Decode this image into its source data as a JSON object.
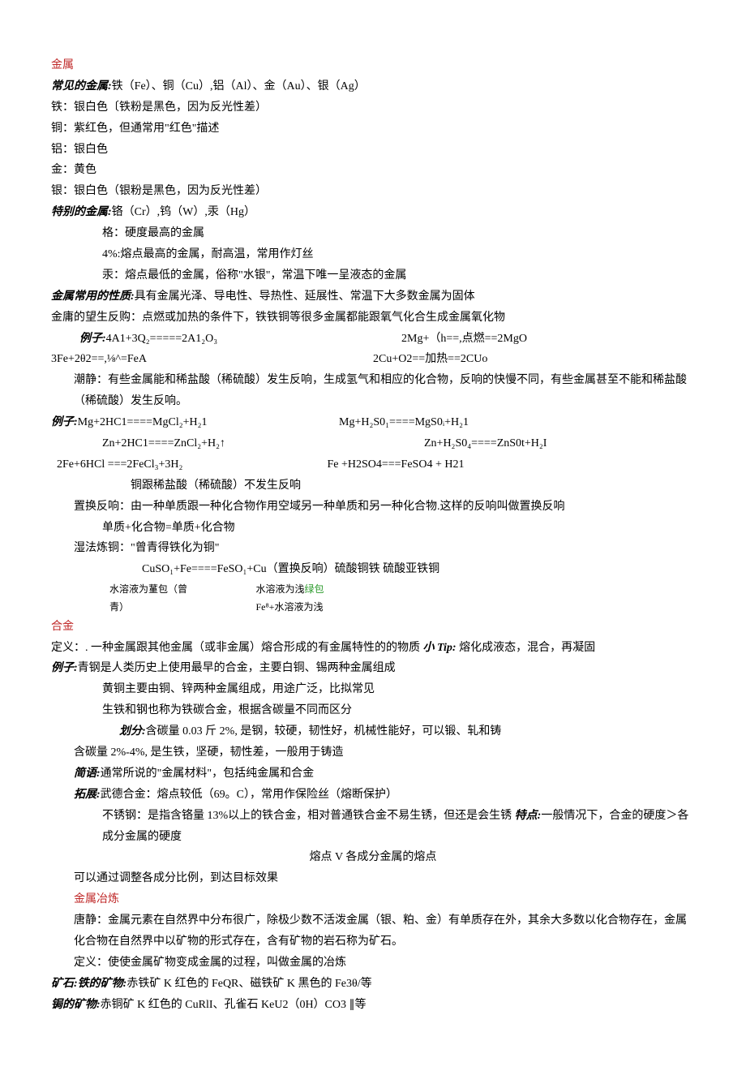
{
  "s1": {
    "title": "金属",
    "common_label": "常见的金属:",
    "common_text": "铁（Fe）、铜（Cu）,铝（Al）、金（Au）、银（Ag）",
    "iron": "铁：银白色〔铁粉是黑色，因为反光性差）",
    "copper": "铜：紫红色，但通常用\"红色\"描述",
    "al": "铝：银白色",
    "gold": "金：黄色",
    "silver": "银：银白色（银粉是黑色，因为反光性差）",
    "special_label": "特别的金属:",
    "special_text": "铬（Cr）,钨（W）,汞（Hg）",
    "cr": "格：硬度最高的金属",
    "w": "4%:熔点最高的金属，耐高温，常用作灯丝",
    "hg": "汞：熔点最低的金属，俗称\"水银\"，常温下唯一呈液态的金属",
    "prop_label": "金属常用的性质:",
    "prop_text": "具有金属光泽、导电性、导热性、延展性、常温下大多数金属为固体",
    "combust": "金庸的望生反购：点燃或加热的条件下，铁铁铜等很多金属都能跟氧气化合生成金属氧化物",
    "ex_label": "例子:",
    "eq1a": "4A1+3Q₂=====2A1₂O₃",
    "eq1b": "2Mg+（h==,点燃==2MgO",
    "eq2a": "3Fe+2θ2==,⅛^=FeA",
    "eq2b": "2Cu+O2==加热==2CUo",
    "acid_desc": "潮静：有些金属能和稀盐酸（稀硫酸）发生反响，生成氢气和相应的化合物，反响的快慢不同，有些金属甚至不能和稀盐酸（稀硫酸）发生反响。",
    "ex2_label": "例子:",
    "eq3a": "Mg+2HC1====MgCl₂+H₂1",
    "eq3b": "Mg+H₂S0₁====MgS0ᵢ+H₂1",
    "eq4a": "Zn+2HC1====ZnCl₂+H₂↑",
    "eq4b": "Zn+H₂S0₄====ZnS0t+H₂I",
    "eq5a": "2Fe+6HCl ===2FeCl₃+3H₂",
    "eq5b": "Fe +H2SO4===FeSO4 + H21",
    "cu_note": "铜跟稀盐酸（稀硫酸）不发生反响",
    "dis_def": "置换反响：由一种单质跟一种化合物作用空域另一种单质和另一种化合物.这样的反响叫做置换反响",
    "dis_eq": "单质+化合物=单质+化合物",
    "wet": "湿法炼铜：\"曾青得铁化为铜\"",
    "wet_eq": "CuSO₁+Fe====FeSO₁+Cu（置换反响）硫酸铜铁        硫酸亚铁铜",
    "wet_c1a": "水溶液为蓳包（曾",
    "wet_c1b": "青）",
    "wet_c2": "水溶液为浅",
    "wet_c2_g": "绿包",
    "wet_c3": "Fe⁸+水溶液为浅"
  },
  "s2": {
    "title": "合金",
    "def_line": "定义：. 一种金属跟其他金属（或非金属）熔合形成的有金属特性的的物质 ",
    "tip_label": "小 Tip:",
    "tip_text": " 熔化成液态，混合，再凝固",
    "ex_label": "例子:",
    "ex_text": "青钢是人类历史上使用最早的合金，主要白铜、锡两种金属组成",
    "brass": "黄铜主要由铜、锌两种金属组成，用途广泛，比拟常见",
    "iron_steel": "生铁和钢也称为铁碳合金，根据含碳量不同而区分",
    "divide_label": "划分:",
    "divide_text": "含碳量 0.03 斤 2%, 是钢，较硬，韧性好，机械性能好，可以锻、轧和铸",
    "pig_iron": "含碳量 2%-4%, 是生铁，坚硬，韧性差，一般用于铸造",
    "brief_label": "简语:",
    "brief_text": "通常所说的\"金属材料\"，包括纯金属和合金",
    "expand_label": "拓展:",
    "expand_text": "武德合金：熔点较低（69。C），常用作保险丝（熔断保护）",
    "stainless": "不锈钢：是指含铬量 13%以上的铁合金，相对普通铁合金不易生锈，但还是会生锈 ",
    "feat_label": "特点:",
    "feat_text": "一般情况下，合金的硬度＞各成分金属的硬度",
    "mp_line": "熔点 V 各成分金属的熔点",
    "adjust": "可以通过调整各成分比例，到达目标效果"
  },
  "s3": {
    "title": "金属冶炼",
    "intro": "唐静：金属元素在自然界中分布很广，除极少数不活泼金属（银、粕、金）有单质存在外，其余大多数以化合物存在，金属化合物在自然界中以矿物的形式存在，含有矿物的岩石称为矿石。",
    "def": "定义：使使金属矿物变成金属的过程，叫做金属的冶炼",
    "ore_label": "矿石:铁的矿物:",
    "ore_text": "赤铁矿 K 红色的 FeQR、磁铁矿 K 黑色的 Fe3θ/等",
    "cu_label": "锔的矿物:",
    "cu_text": "赤铜矿 K 红色的 CuRlI、孔雀石 KeU2（0H）CO3 ∥等"
  }
}
